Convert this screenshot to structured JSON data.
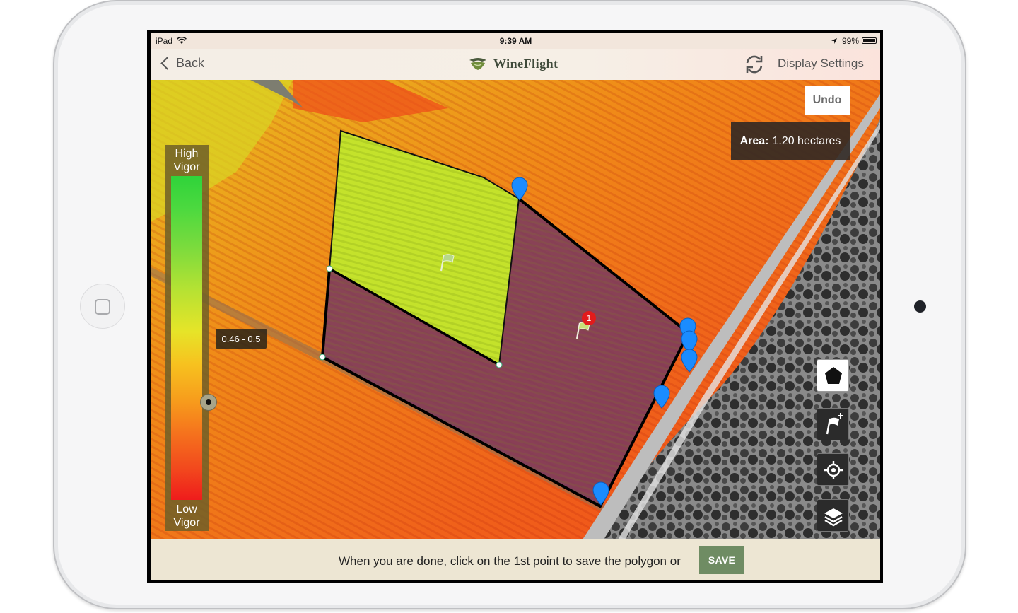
{
  "statusbar": {
    "device": "iPad",
    "time": "9:39 AM",
    "battery": "99%"
  },
  "navbar": {
    "back_label": "Back",
    "app_name": "WineFlight",
    "display_settings_label": "Display Settings",
    "refresh_icon": "refresh-icon"
  },
  "map": {
    "undo_label": "Undo",
    "area_label": "Area:",
    "area_value": "1.20 hectares",
    "legend_high": "High Vigor",
    "legend_low": "Low Vigor",
    "range_label": "0.46 - 0.5",
    "flag_badge": "1",
    "tools": [
      "polygon-tool-icon",
      "add-flag-icon",
      "locate-icon",
      "layers-icon"
    ]
  },
  "bottom": {
    "message": "When you are done, click on the 1st point to save the polygon or",
    "save_label": "SAVE"
  },
  "colors": {
    "save_green": "#6f8c63",
    "bottom_bg": "#ede6d3",
    "marker_blue": "#1a8cff",
    "selected_fill": "#7a3a5e"
  }
}
